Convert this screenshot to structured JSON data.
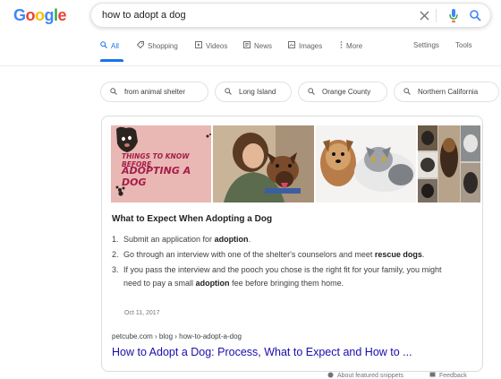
{
  "logo": {
    "text": "Google",
    "letters": [
      "G",
      "o",
      "o",
      "g",
      "l",
      "e"
    ],
    "colors": [
      "#4285f4",
      "#ea4335",
      "#fbbc05",
      "#4285f4",
      "#34a853",
      "#ea4335"
    ]
  },
  "search": {
    "value": "how to adopt a dog",
    "icons": [
      "clear-icon",
      "microphone-icon",
      "search-icon"
    ]
  },
  "tabs": [
    {
      "label": "All",
      "icon": "search-icon"
    },
    {
      "label": "Shopping",
      "icon": "tag-icon"
    },
    {
      "label": "Videos",
      "icon": "video-icon"
    },
    {
      "label": "News",
      "icon": "news-icon"
    },
    {
      "label": "Images",
      "icon": "image-icon"
    },
    {
      "label": "More",
      "icon": "more-icon"
    }
  ],
  "tools": {
    "settings": "Settings",
    "tools": "Tools"
  },
  "chips": [
    "from animal shelter",
    "Long Island",
    "Orange County",
    "Northern California"
  ],
  "featured": {
    "image_banner_line1": "THINGS TO KNOW BEFORE",
    "image_banner_line2": "ADOPTING A DOG",
    "title": "What to Expect When Adopting a Dog",
    "steps": [
      {
        "num": "1.",
        "before": "Submit an application for ",
        "bold": "adoption",
        "after": "."
      },
      {
        "num": "2.",
        "before": "Go through an interview with one of the shelter's counselors and meet ",
        "bold": "rescue dogs",
        "after": "."
      },
      {
        "num": "3.",
        "before": "If you pass the interview and the pooch you chose is the right fit for your family, you might need to pay a small ",
        "bold": "adoption",
        "after": " fee before bringing them home."
      }
    ],
    "date": "Oct 11, 2017",
    "cite": "petcube.com › blog › how-to-adopt-a-dog",
    "link": "How to Adopt a Dog: Process, What to Expect and How to ..."
  },
  "footer": {
    "about": "About featured snippets",
    "feedback": "Feedback"
  },
  "colors": {
    "accent": "#1a73e8",
    "link": "#1a0dab",
    "banner_bg": "#e9b8b4",
    "banner_text": "#a51d4a"
  }
}
